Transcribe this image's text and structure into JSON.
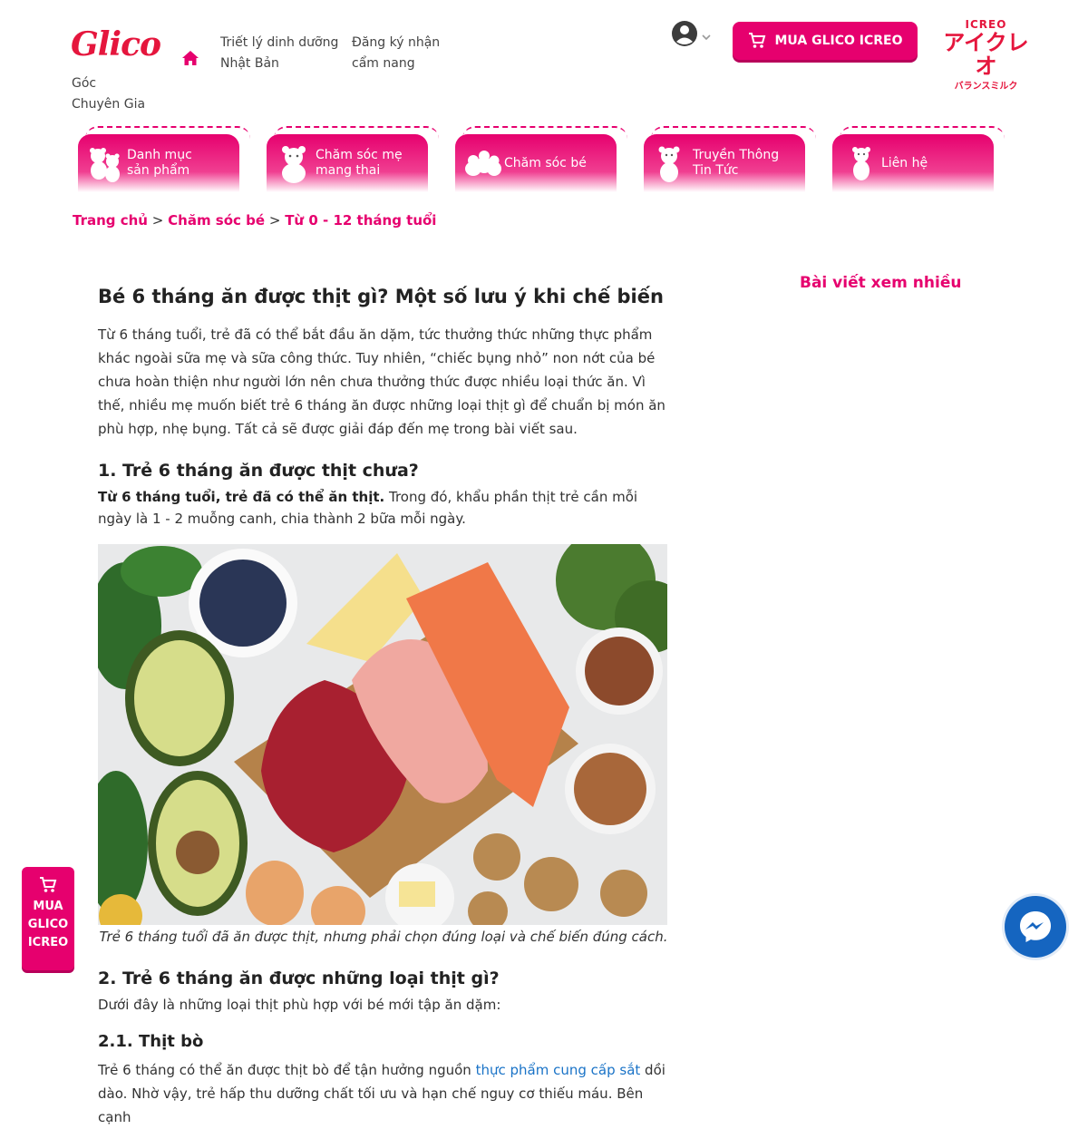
{
  "header": {
    "logo_text": "Glico",
    "nav": [
      {
        "line1": "Triết lý dinh dưỡng",
        "line2": "Nhật Bản"
      },
      {
        "line1": "Đăng ký nhận",
        "line2": "cẩm nang"
      },
      {
        "line1": "Góc",
        "line2": "Chuyên Gia"
      }
    ],
    "buy_label": "MUA GLICO ICREO",
    "icreo": {
      "top": "ICREO",
      "main": "アイクレオ",
      "sub": "バランスミルク"
    }
  },
  "tabs": [
    {
      "line1": "Danh mục",
      "line2": "sản phẩm"
    },
    {
      "line1": "Chăm sóc mẹ",
      "line2": "mang thai"
    },
    {
      "line1": "Chăm sóc bé",
      "line2": ""
    },
    {
      "line1": "Truyền Thông",
      "line2": "Tin Tức"
    },
    {
      "line1": "Liên hệ",
      "line2": ""
    }
  ],
  "breadcrumb": {
    "items": [
      "Trang chủ",
      "Chăm sóc bé",
      "Từ 0 - 12 tháng tuổi"
    ],
    "separator": ">"
  },
  "article": {
    "title": "Bé 6 tháng ăn được thịt gì? Một số lưu ý khi chế biến",
    "intro": "Từ 6 tháng tuổi, trẻ đã có thể bắt đầu ăn dặm, tức thưởng thức những thực phẩm khác ngoài sữa mẹ và sữa công thức. Tuy nhiên, “chiếc bụng nhỏ” non nớt của bé chưa hoàn thiện như người lớn nên chưa thưởng thức được nhiều loại thức ăn. Vì thế, nhiều mẹ muốn biết trẻ 6 tháng ăn được những loại thịt gì để chuẩn bị món ăn phù hợp, nhẹ bụng. Tất cả sẽ được giải đáp đến mẹ trong bài viết sau.",
    "h2_1": "1. Trẻ 6 tháng ăn được thịt chưa?",
    "p1_bold": "Từ 6 tháng tuổi, trẻ đã có thể ăn thịt.",
    "p1_rest": " Trong đó, khẩu phần thịt trẻ cần mỗi ngày là 1 - 2 muỗng canh, chia thành 2 bữa mỗi ngày.",
    "caption": "Trẻ 6 tháng tuổi đã ăn được thịt, nhưng phải chọn đúng loại và chế biến đúng cách.",
    "h2_2": "2. Trẻ 6 tháng ăn được những loại thịt gì?",
    "p2": "Dưới đây là những loại thịt phù hợp với bé mới tập ăn dặm:",
    "h3_1": "2.1. Thịt bò",
    "p3_pre": "Trẻ 6 tháng có thể ăn được thịt bò để tận hưởng nguồn ",
    "p3_link": "thực phẩm cung cấp sắt",
    "p3_post": " dồi dào. Nhờ vậy, trẻ hấp thu dưỡng chất tối ưu và hạn chế nguy cơ thiếu máu. Bên cạnh"
  },
  "sidebar": {
    "title": "Bài viết xem nhiều"
  },
  "floating": {
    "buy_lines": [
      "MUA",
      "GLICO",
      "ICREO"
    ]
  },
  "colors": {
    "brand_pink": "#e6006e",
    "logo_red": "#e5163d",
    "link_blue": "#1a73c7",
    "messenger_blue": "#1565c0"
  },
  "icons": [
    "home-icon",
    "user-icon",
    "chevron-down-icon",
    "cart-icon",
    "bear-icon",
    "messenger-icon"
  ]
}
